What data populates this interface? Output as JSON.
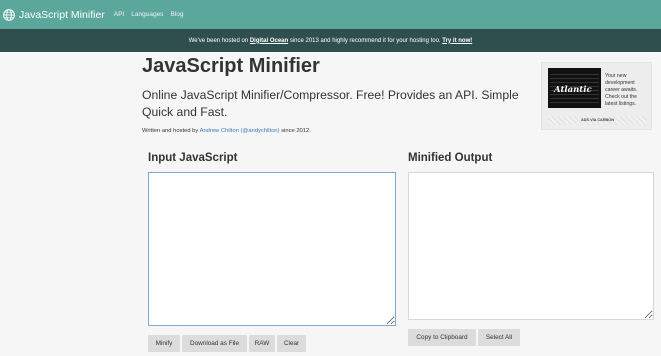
{
  "nav": {
    "brand": "JavaScript Minifier",
    "links": [
      "API",
      "Languages",
      "Blog"
    ]
  },
  "banner": {
    "text_before": "We've been hosted on ",
    "link1": "Digital Ocean",
    "text_middle": " since 2013 and highly recommend it for your hosting too. ",
    "link2": "Try it now!"
  },
  "page": {
    "title": "JavaScript Minifier",
    "subtitle": "Online JavaScript Minifier/Compressor. Free! Provides an API. Simple Quick and Fast.",
    "credit_before": "Written and hosted by ",
    "credit_link": "Andrew Chilton (@andychilton)",
    "credit_after": " since 2012."
  },
  "ad": {
    "image_text": "Atlantic",
    "text": "Your new development career awaits. Check out the latest listings.",
    "footer": "ADS VIA CARBON"
  },
  "input": {
    "heading": "Input JavaScript",
    "value": ""
  },
  "output": {
    "heading": "Minified Output",
    "value": ""
  },
  "buttons": {
    "minify": "Minify",
    "download": "Download as File",
    "raw": "RAW",
    "clear": "Clear",
    "copy": "Copy to Clipboard",
    "select_all": "Select All"
  },
  "colors": {
    "navbar": "#5ba79c",
    "banner": "#2f4f4f",
    "link": "#3b78b8",
    "input_focus_border": "#7fa7dd",
    "button": "#dcdcdc"
  },
  "icons": {
    "brand": "globe-icon"
  }
}
